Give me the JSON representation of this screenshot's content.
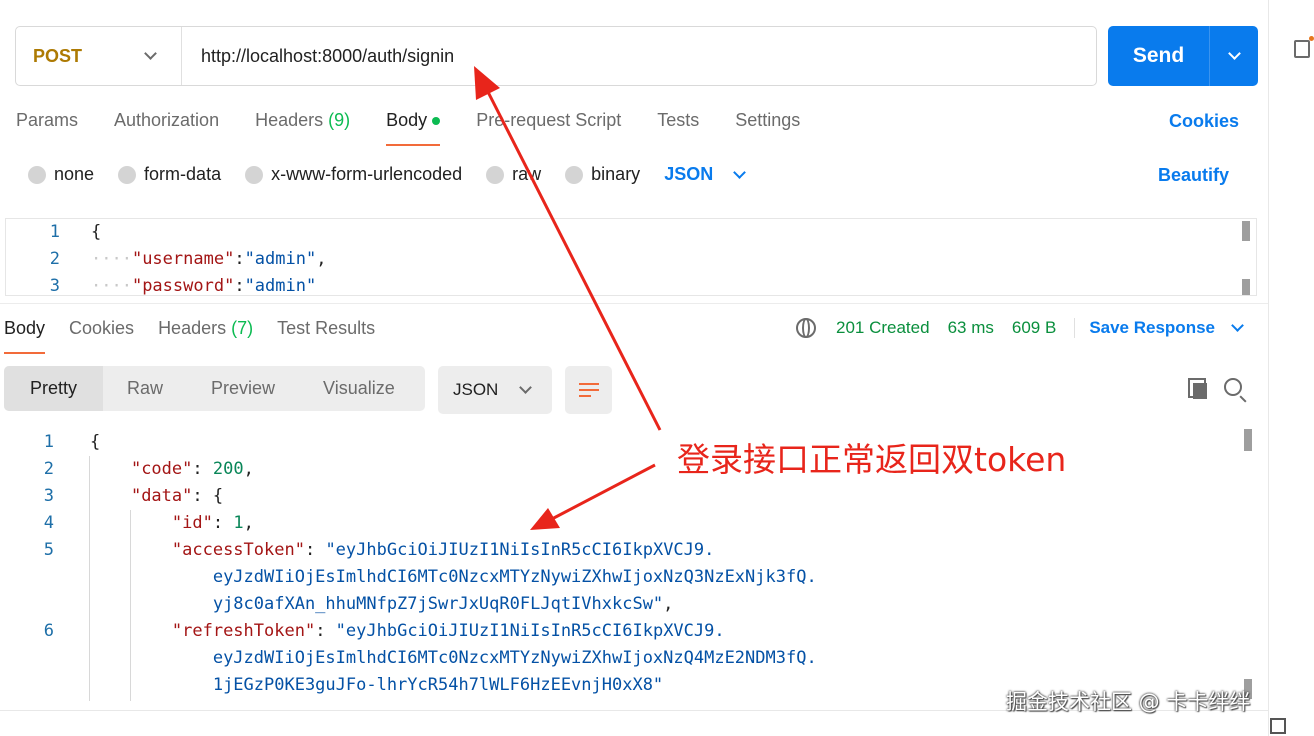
{
  "request": {
    "method": "POST",
    "url": "http://localhost:8000/auth/signin",
    "send_label": "Send"
  },
  "request_tabs": [
    {
      "label": "Params"
    },
    {
      "label": "Authorization"
    },
    {
      "label": "Headers",
      "count": "(9)"
    },
    {
      "label": "Body",
      "active": true
    },
    {
      "label": "Pre-request Script"
    },
    {
      "label": "Tests"
    },
    {
      "label": "Settings"
    }
  ],
  "cookies_label": "Cookies",
  "body_types": [
    "none",
    "form-data",
    "x-www-form-urlencoded",
    "raw",
    "binary"
  ],
  "body_format": "JSON",
  "beautify_label": "Beautify",
  "request_body": {
    "line_numbers": [
      "1",
      "2",
      "3"
    ],
    "brace": "{",
    "username_key": "\"username\"",
    "username_val": "\"admin\"",
    "password_key": "\"password\"",
    "password_val": "\"admin\""
  },
  "response_tabs": [
    {
      "label": "Body",
      "active": true
    },
    {
      "label": "Cookies"
    },
    {
      "label": "Headers",
      "count": "(7)"
    },
    {
      "label": "Test Results"
    }
  ],
  "response_status": {
    "status": "201 Created",
    "time": "63 ms",
    "size": "609 B",
    "save_label": "Save Response"
  },
  "view_modes": [
    "Pretty",
    "Raw",
    "Preview",
    "Visualize"
  ],
  "response_format": "JSON",
  "response_body": {
    "line_numbers": [
      "1",
      "2",
      "3",
      "4",
      "5",
      "6"
    ],
    "brace": "{",
    "code_key": "\"code\"",
    "code_val": "200",
    "data_key": "\"data\"",
    "id_key": "\"id\"",
    "id_val": "1",
    "access_key": "\"accessToken\"",
    "access_val_1": "\"eyJhbGciOiJIUzI1NiIsInR5cCI6IkpXVCJ9.",
    "access_val_2": "eyJzdWIiOjEsImlhdCI6MTc0NzcxMTYzNywiZXhwIjoxNzQ3NzExNjk3fQ.",
    "access_val_3": "yj8c0afXAn_hhuMNfpZ7jSwrJxUqR0FLJqtIVhxkcSw\"",
    "refresh_key": "\"refreshToken\"",
    "refresh_val_1": "\"eyJhbGciOiJIUzI1NiIsInR5cCI6IkpXVCJ9.",
    "refresh_val_2": "eyJzdWIiOjEsImlhdCI6MTc0NzcxMTYzNywiZXhwIjoxNzQ4MzE2NDM3fQ.",
    "refresh_val_3": "1jEGzP0KE3guJFo-lhrYcR54h7lWLF6HzEEvnjH0xX8\""
  },
  "annotation": "登录接口正常返回双token",
  "watermark": "掘金技术社区 @ 卡卡绊绊",
  "colors": {
    "accent_blue": "#097bed",
    "method_color": "#ad7a03",
    "success_green": "#0cbb52",
    "annotation_red": "#e8251b",
    "active_tab_underline": "#f26b3a"
  },
  "icons": [
    "chevron-down-icon",
    "globe-icon",
    "wrap-lines-icon",
    "copy-icon",
    "search-icon",
    "status-dot-icon"
  ]
}
